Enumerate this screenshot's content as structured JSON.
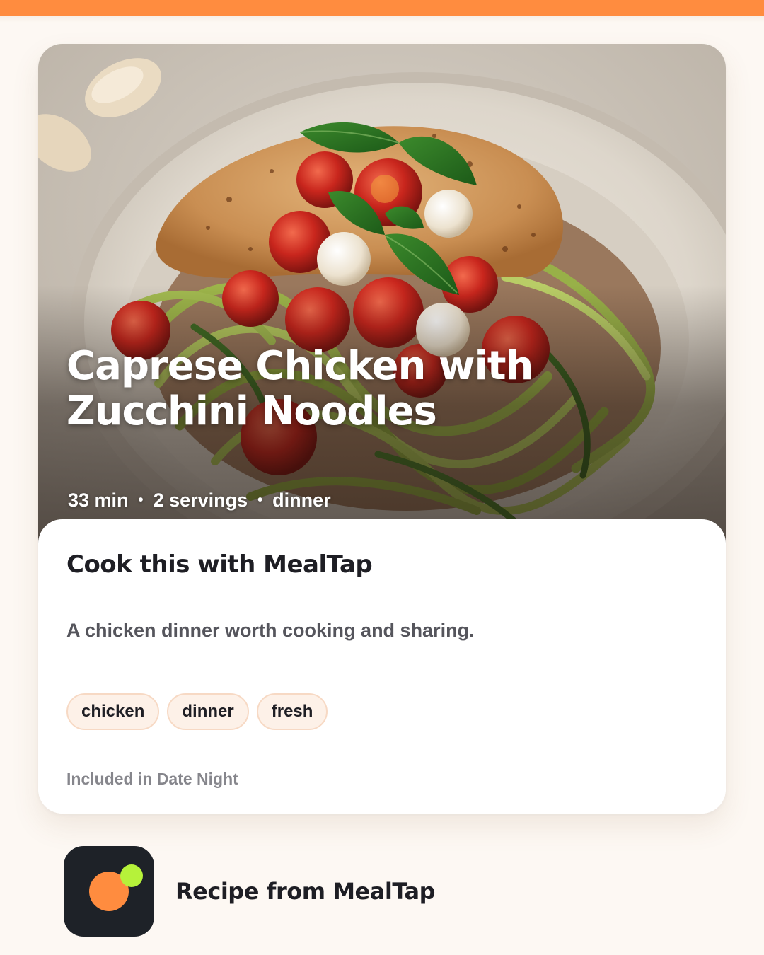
{
  "brand": {
    "accent": "#ff8c3f",
    "accent_secondary": "#b6f23a",
    "icon_bg": "#1e2228"
  },
  "recipe": {
    "title": "Caprese Chicken with Zucchini Noodles",
    "image_icon": "food-photo",
    "meta": {
      "time": "33 min",
      "separator": "•",
      "servings": "2 servings",
      "meal": "dinner"
    }
  },
  "panel": {
    "title": "Cook this with MealTap",
    "description": "A chicken dinner worth cooking and sharing.",
    "tags": [
      "chicken",
      "dinner",
      "fresh"
    ],
    "collection": "Included in Date Night"
  },
  "footer": {
    "app_icon": "mealtap-logo-icon",
    "text": "Recipe from MealTap"
  }
}
